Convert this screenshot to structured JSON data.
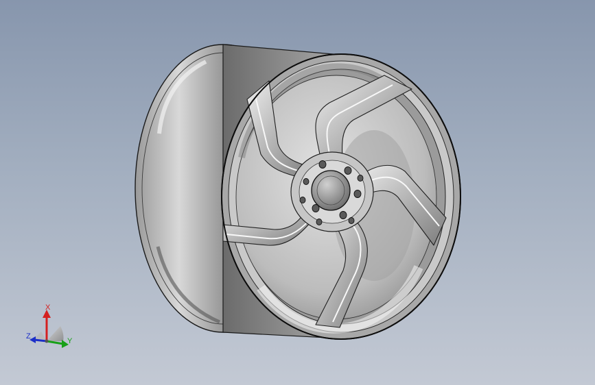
{
  "viewport": {
    "background_top": "#8796ad",
    "background_bottom": "#c3c9d4"
  },
  "model": {
    "spoke_count": 5,
    "lug_hole_count": 5,
    "metal_color": "#b8b8b8",
    "edge_color": "#1a1a1a"
  },
  "triad": {
    "x_label": "X",
    "y_label": "Y",
    "z_label": "Z",
    "x_color": "#d42020",
    "y_color": "#18a018",
    "z_color": "#1c2fc8"
  }
}
